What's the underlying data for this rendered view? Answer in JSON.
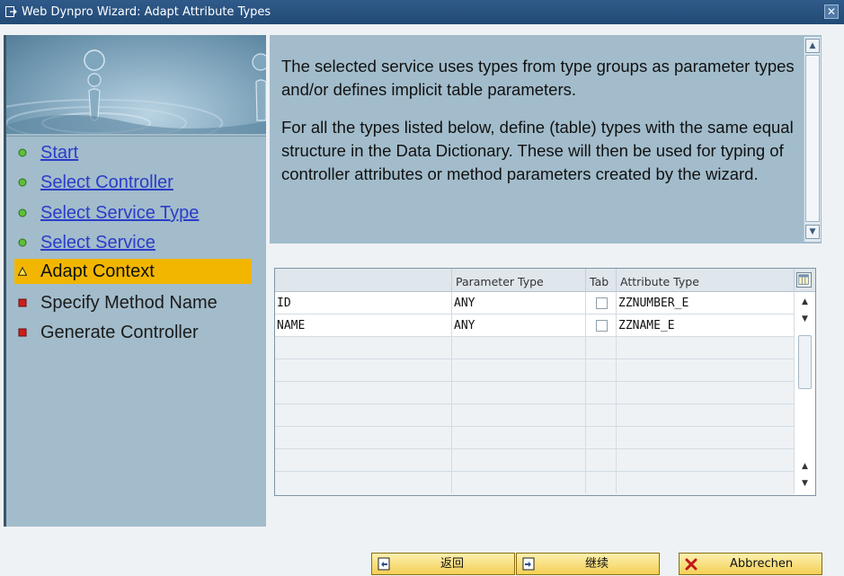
{
  "window": {
    "title": "Web Dynpro Wizard: Adapt Attribute Types",
    "close_glyph": "✕"
  },
  "roadmap": {
    "steps": [
      {
        "label": "Start",
        "state": "done"
      },
      {
        "label": "Select Controller",
        "state": "done"
      },
      {
        "label": "Select Service Type",
        "state": "done"
      },
      {
        "label": "Select Service",
        "state": "done"
      },
      {
        "label": "Adapt Context",
        "state": "current"
      },
      {
        "label": "Specify Method Name",
        "state": "pending"
      },
      {
        "label": "Generate Controller",
        "state": "pending"
      }
    ]
  },
  "info": {
    "paragraph1": "The selected service uses types from type groups as parameter types and/or defines implicit table parameters.",
    "paragraph2": "For all the types listed below, define (table) types with the same equal structure in the Data Dictionary. These will then be used for typing of controller attributes or method parameters created by the wizard."
  },
  "table": {
    "headers": {
      "name": "",
      "param_type": "Parameter Type",
      "tab": "Tab",
      "attr_type": "Attribute Type"
    },
    "rows": [
      {
        "name": "ID",
        "param_type": "ANY",
        "tab": false,
        "attr_type": "ZZNUMBER_E"
      },
      {
        "name": "NAME",
        "param_type": "ANY",
        "tab": false,
        "attr_type": "ZZNAME_E"
      }
    ]
  },
  "buttons": {
    "back": "返回",
    "continue": "继续",
    "cancel": "Abbrechen"
  },
  "colors": {
    "title_bar": "#2b5482",
    "panel": "#a2bccb",
    "active_step": "#f2b600",
    "done_dot": "#5fbf3a",
    "pending_dot": "#cc1f1f",
    "link": "#2b3cc8"
  }
}
